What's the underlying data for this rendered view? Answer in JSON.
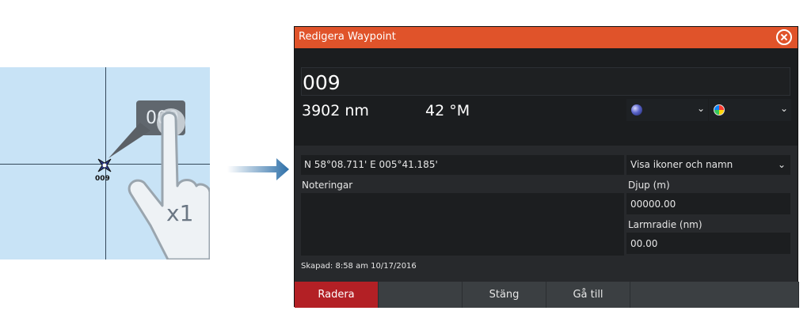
{
  "illustration": {
    "waypoint_label": "009",
    "popup_text": "009",
    "tap_count": "x1"
  },
  "dialog": {
    "title": "Redigera Waypoint",
    "name": "009",
    "distance": "3902 nm",
    "bearing": "42 °M",
    "coordinates": "N 58°08.711'   E 005°41.185'",
    "display_option": "Visa ikoner och namn",
    "notes_label": "Noteringar",
    "notes_value": "",
    "depth_label": "Djup (m)",
    "depth_value": "00000.00",
    "alarm_label": "Larmradie (nm)",
    "alarm_value": "00.00",
    "created": "Skapad: 8:58 am  10/17/2016",
    "buttons": {
      "delete": "Radera",
      "close": "Stäng",
      "goto": "Gå till"
    }
  },
  "colors": {
    "titlebar": "#e0532a",
    "delete_button": "#b32025",
    "map_water": "#c8e3f6"
  },
  "icons": {
    "symbol_select": "blue-sphere-icon",
    "color_select": "color-wheel-icon",
    "close": "close-icon"
  }
}
